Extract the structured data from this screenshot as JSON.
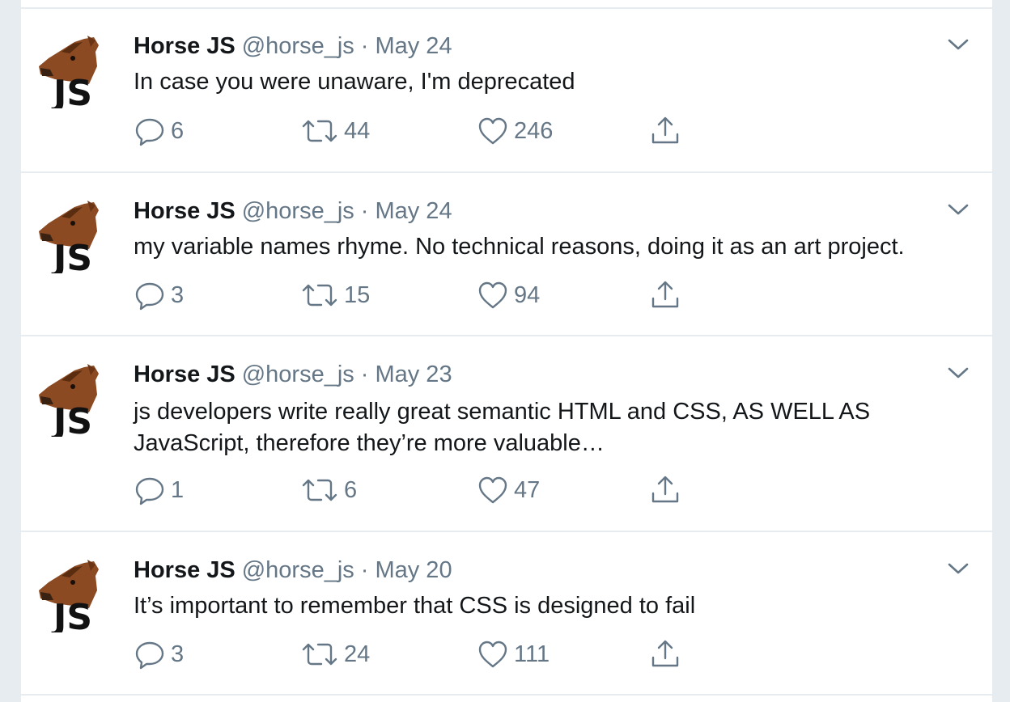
{
  "colors": {
    "background": "#e6ecf0",
    "card": "#ffffff",
    "text": "#14171a",
    "secondary": "#657786"
  },
  "icons": {
    "avatar": "horse-head-js-avatar",
    "caret": "chevron-down-icon",
    "reply": "speech-bubble-icon",
    "retweet": "retweet-arrows-icon",
    "like": "heart-icon",
    "share": "share-upload-icon"
  },
  "avatar_text": "JS",
  "tweets": [
    {
      "name": "Horse JS",
      "handle": "@horse_js",
      "separator": "·",
      "date": "May 24",
      "text": "In case you were unaware, I'm deprecated",
      "replies": "6",
      "retweets": "44",
      "likes": "246"
    },
    {
      "name": "Horse JS",
      "handle": "@horse_js",
      "separator": "·",
      "date": "May 24",
      "text": "my variable names rhyme. No technical reasons, doing it as an art project.",
      "replies": "3",
      "retweets": "15",
      "likes": "94"
    },
    {
      "name": "Horse JS",
      "handle": "@horse_js",
      "separator": "·",
      "date": "May 23",
      "text": "js developers write really great semantic HTML and CSS, AS WELL AS JavaScript, therefore they’re more valuable…",
      "replies": "1",
      "retweets": "6",
      "likes": "47"
    },
    {
      "name": "Horse JS",
      "handle": "@horse_js",
      "separator": "·",
      "date": "May 20",
      "text": "It’s important to remember that CSS is designed to fail",
      "replies": "3",
      "retweets": "24",
      "likes": "111"
    }
  ]
}
